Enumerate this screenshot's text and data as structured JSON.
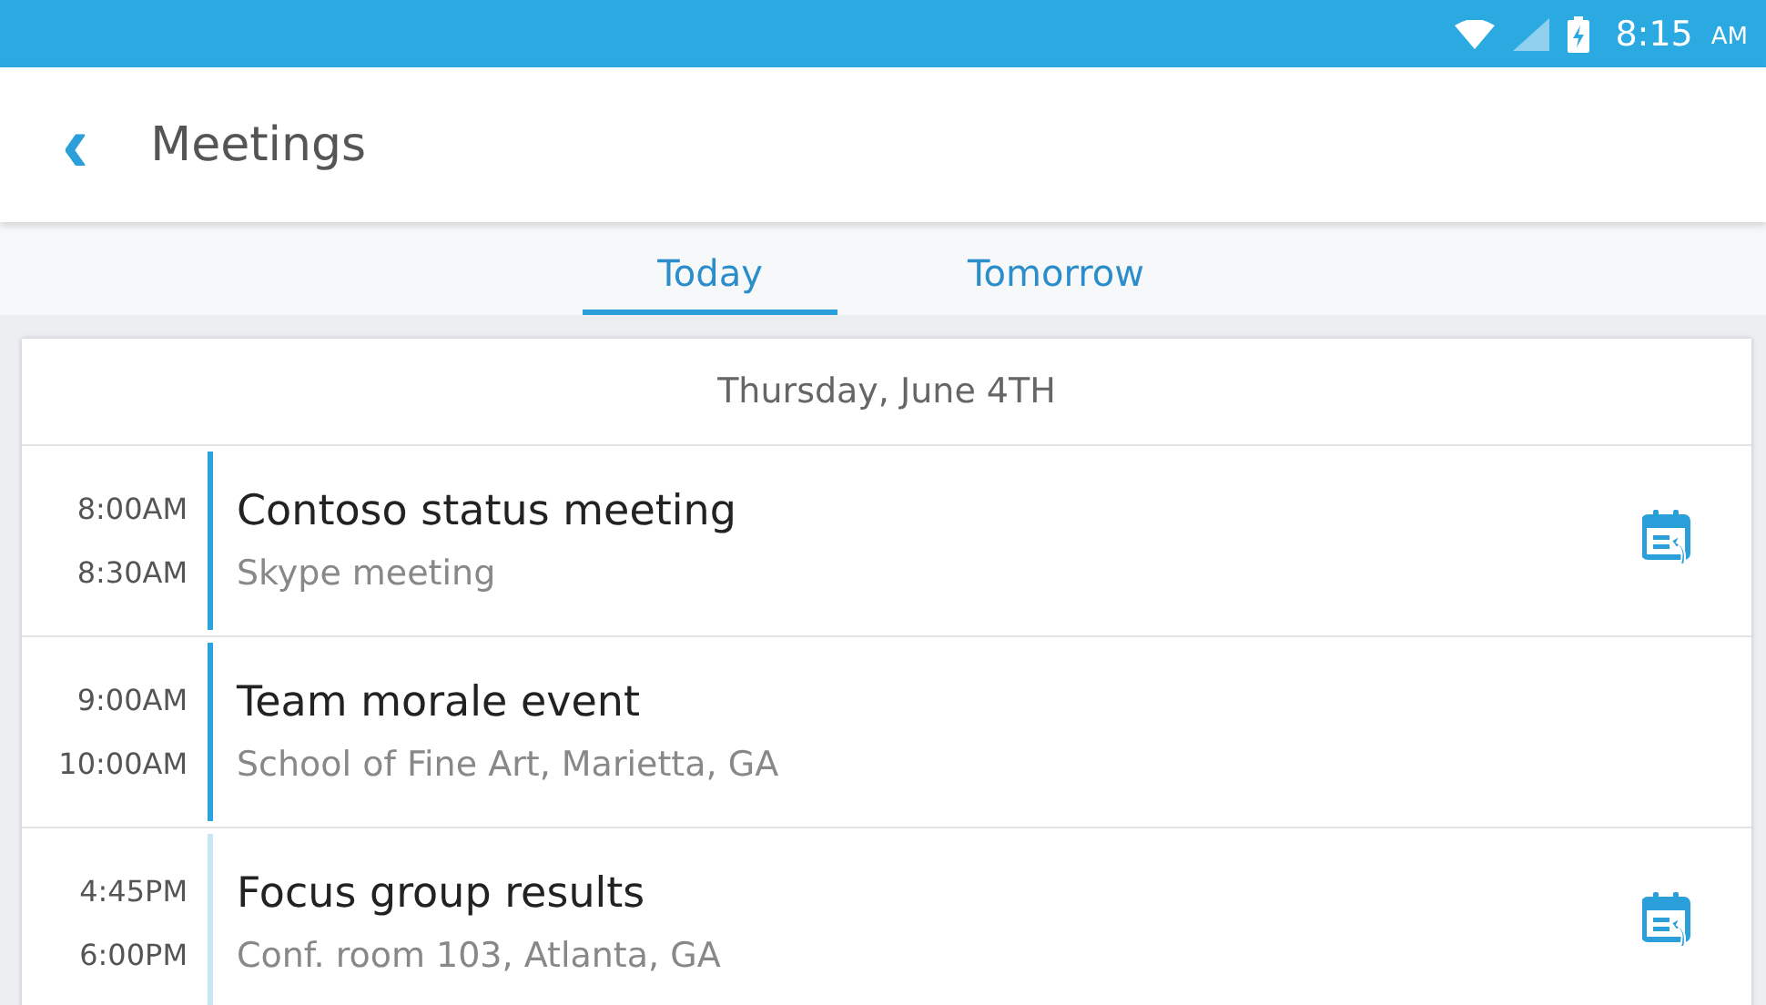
{
  "status_bar": {
    "time": "8:15",
    "ampm": "AM"
  },
  "header": {
    "back": "‹",
    "title": "Meetings"
  },
  "tabs": [
    {
      "label": "Today",
      "selected": true
    },
    {
      "label": "Tomorrow",
      "selected": false
    }
  ],
  "date": "Thursday, June 4TH",
  "meetings": [
    {
      "start": "8:00AM",
      "end": "8:30AM",
      "title": "Contoso status meeting",
      "location": "Skype meeting",
      "color": "#2ba3dc",
      "join_icon": true
    },
    {
      "start": "9:00AM",
      "end": "10:00AM",
      "title": "Team morale event",
      "location": "School of Fine Art, Marietta, GA",
      "color": "#2ba3dc",
      "join_icon": false
    },
    {
      "start": "4:45PM",
      "end": "6:00PM",
      "title": "Focus group results",
      "location": "Conf. room 103, Atlanta, GA",
      "color": "#c9e6f5",
      "join_icon": true
    }
  ]
}
